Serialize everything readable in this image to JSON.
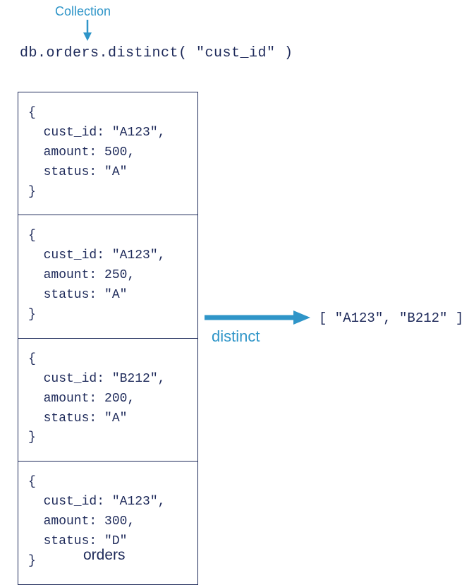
{
  "annotation": {
    "collection_label": "Collection"
  },
  "query": "db.orders.distinct( \"cust_id\" )",
  "documents": [
    "{\n  cust_id: \"A123\",\n  amount: 500,\n  status: \"A\"\n}",
    "{\n  cust_id: \"A123\",\n  amount: 250,\n  status: \"A\"\n}",
    "{\n  cust_id: \"B212\",\n  amount: 200,\n  status: \"A\"\n}",
    "{\n  cust_id: \"A123\",\n  amount: 300,\n  status: \"D\"\n}"
  ],
  "collection_name": "orders",
  "operation_label": "distinct",
  "result": "[ \"A123\", \"B212\" ]",
  "colors": {
    "accent": "#2f95c8",
    "text": "#1e2a5a"
  }
}
